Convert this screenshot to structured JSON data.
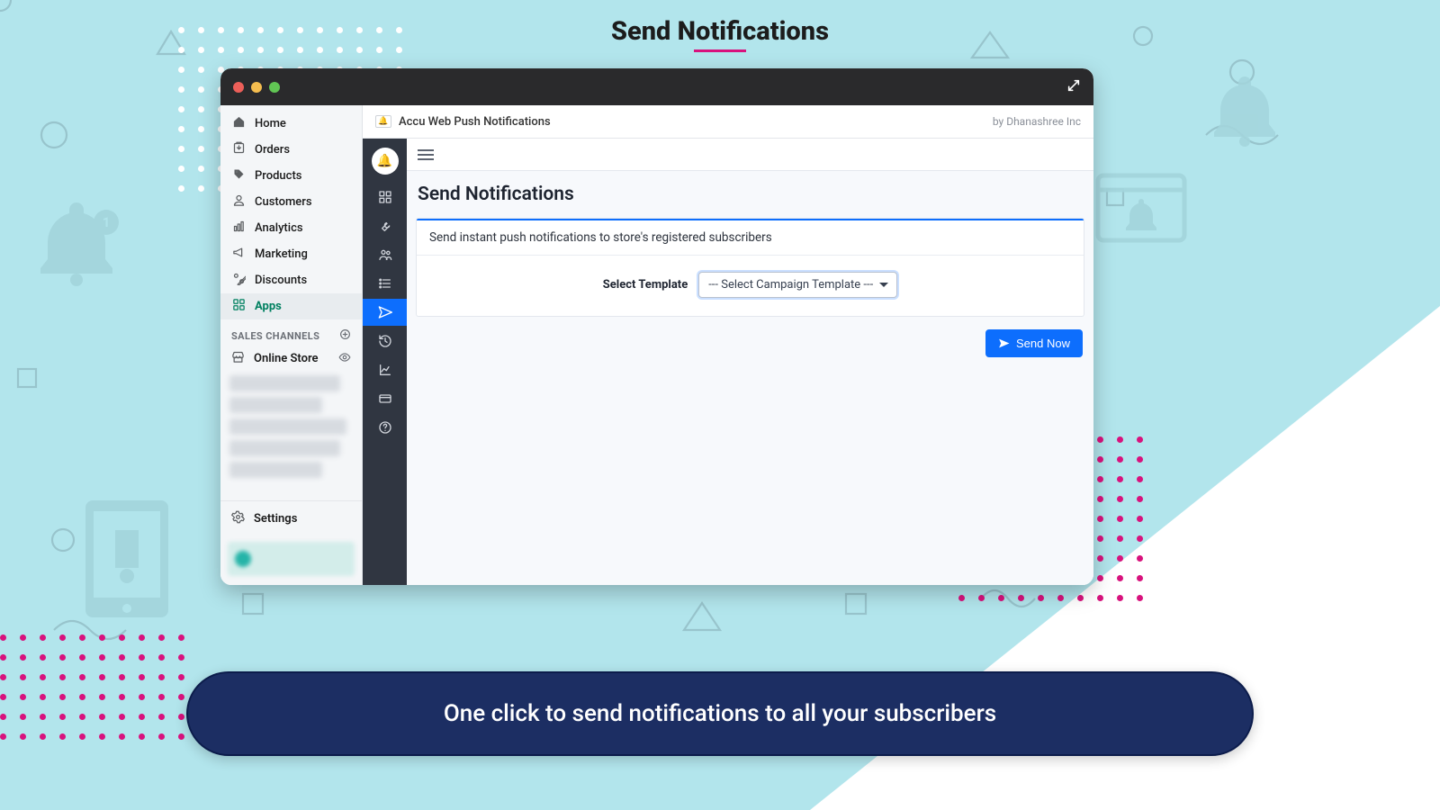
{
  "page": {
    "heading": "Send Notifications",
    "caption": "One click to send notifications to all your subscribers"
  },
  "window": {
    "app_title": "Accu Web Push Notifications",
    "by_label": "by Dhanashree Inc"
  },
  "shopify_sidebar": {
    "items": [
      {
        "icon": "home",
        "label": "Home"
      },
      {
        "icon": "orders",
        "label": "Orders"
      },
      {
        "icon": "tag",
        "label": "Products"
      },
      {
        "icon": "user",
        "label": "Customers"
      },
      {
        "icon": "analytics",
        "label": "Analytics"
      },
      {
        "icon": "megaphone",
        "label": "Marketing"
      },
      {
        "icon": "percent",
        "label": "Discounts"
      },
      {
        "icon": "apps",
        "label": "Apps",
        "active": true
      }
    ],
    "sales_channels_label": "SALES CHANNELS",
    "online_store_label": "Online Store",
    "settings_label": "Settings"
  },
  "icon_rail": [
    {
      "name": "dashboard-icon"
    },
    {
      "name": "wrench-icon"
    },
    {
      "name": "users-icon"
    },
    {
      "name": "list-icon"
    },
    {
      "name": "send-icon",
      "active": true
    },
    {
      "name": "history-icon"
    },
    {
      "name": "chart-icon"
    },
    {
      "name": "card-icon"
    },
    {
      "name": "help-icon"
    }
  ],
  "content": {
    "title": "Send Notifications",
    "card_header": "Send instant push notifications to store's registered subscribers",
    "select_label": "Select Template",
    "select_placeholder": "--- Select Campaign Template ---",
    "send_button": "Send Now"
  }
}
